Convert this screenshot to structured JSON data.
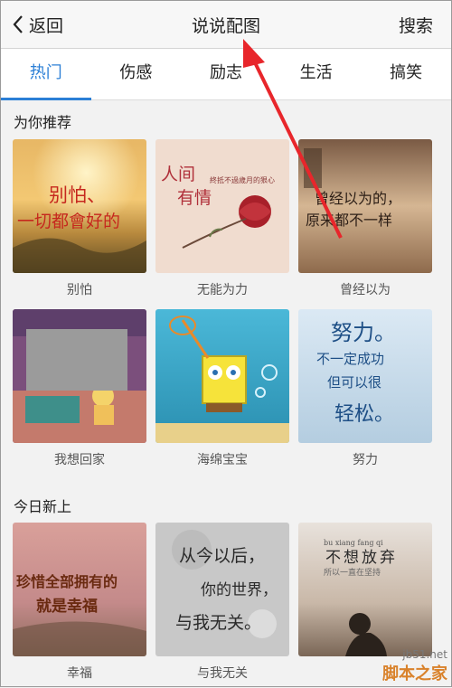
{
  "header": {
    "back_label": "返回",
    "title": "说说配图",
    "search_label": "搜索"
  },
  "tabs": [
    {
      "label": "热门"
    },
    {
      "label": "伤感"
    },
    {
      "label": "励志"
    },
    {
      "label": "生活"
    },
    {
      "label": "搞笑"
    }
  ],
  "sections": {
    "recommended": {
      "title": "为你推荐",
      "items": [
        {
          "caption": "别怕",
          "text_line1": "别怕、",
          "text_line2": "一切都會好的"
        },
        {
          "caption": "无能为力",
          "text_line1": "人间",
          "text_line2": "有情",
          "small_text": "終抵不過歲月的狠心"
        },
        {
          "caption": "曾经以为",
          "text_line1": "曾经以为的，",
          "text_line2": "原来都不一样"
        },
        {
          "caption": "我想回家"
        },
        {
          "caption": "海绵宝宝"
        },
        {
          "caption": "努力",
          "text_line1": "努力。",
          "text_line2": "不一定成功",
          "text_line3": "但可以很",
          "text_line4": "轻松。"
        }
      ]
    },
    "new_today": {
      "title": "今日新上",
      "items": [
        {
          "caption": "幸福",
          "text_line1": "珍惜全部拥有的",
          "text_line2": "就是幸福"
        },
        {
          "caption": "与我无关",
          "text_line1": "从今以后，",
          "text_line2": "你的世界，",
          "text_line3": "与我无关。"
        },
        {
          "caption": "",
          "pinyin": "bu xiang fang qi",
          "text_line1": "不想放弃",
          "small_text": "所以一直在坚持"
        }
      ]
    }
  },
  "watermark": {
    "url": "jb51.net",
    "name": "脚本之家"
  },
  "colors": {
    "accent": "#2b7fd6",
    "arrow": "#e8262b"
  }
}
